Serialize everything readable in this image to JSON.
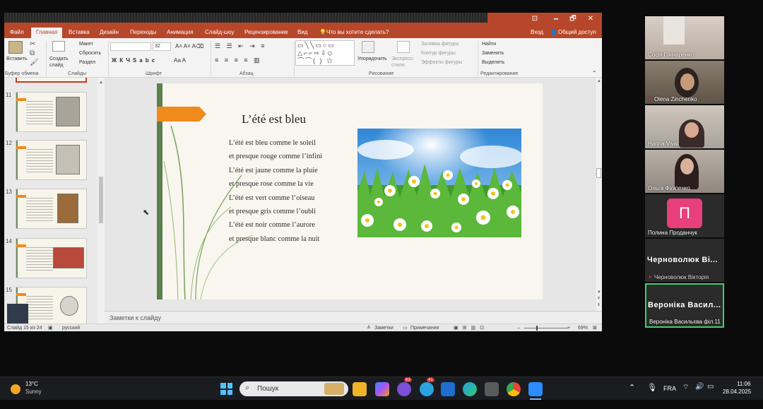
{
  "titlebar": {
    "sign_in": "Вход",
    "share": "Общий доступ",
    "min": "🗕",
    "restore": "🗗",
    "close": "✕",
    "ribbon_toggle": "⊡"
  },
  "tabs": [
    "Файл",
    "Главная",
    "Вставка",
    "Дизайн",
    "Переходы",
    "Анимация",
    "Слайд-шоу",
    "Рецензирование",
    "Вид"
  ],
  "tell_me": "Что вы хотите сделать?",
  "ribbon": {
    "paste": "Вставить",
    "clipboard": "Буфер обмена",
    "new_slide": "Создать слайд",
    "layout": "Макет",
    "reset": "Сбросить",
    "section": "Раздел",
    "slides_group": "Слайды",
    "font_size": "32",
    "font_group": "Шрифт",
    "paragraph_group": "Абзац",
    "arrange": "Упорядочить",
    "quick_styles": "Экспресс-стили",
    "shape_fill": "Заливка фигуры",
    "shape_outline": "Контур фигуры",
    "shape_effects": "Эффекты фигуры",
    "drawing_group": "Рисование",
    "find": "Найти",
    "replace": "Заменить",
    "select": "Выделить",
    "editing_group": "Редактирование"
  },
  "thumbnails": [
    {
      "num": "11"
    },
    {
      "num": "12"
    },
    {
      "num": "13"
    },
    {
      "num": "14"
    },
    {
      "num": "15"
    }
  ],
  "slide": {
    "title": "L’été est bleu",
    "lines": [
      "L’été est bleu comme le soleil",
      "et presque rouge comme l’infini",
      "L’été est jaune comme la pluie",
      "et presque rose comme la vie",
      "L’été est vert comme l’oiseau",
      "et presque gris comme l’oubli",
      "L’été est noir comme l’aurore",
      "et presque blanc comme la nuit"
    ]
  },
  "notes_placeholder": "Заметки к слайду",
  "status": {
    "slide_count": "Слайд 15 из 24",
    "language": "русский",
    "notes": "Заметки",
    "comments": "Примечания",
    "zoom": "69%"
  },
  "participants": [
    {
      "name": "Сосія Гончаренко"
    },
    {
      "name": "Olena Zinchenko"
    },
    {
      "name": "Hanna Vivat"
    },
    {
      "name": "Ольга Філіпенко"
    },
    {
      "name": "Полина Проданчук",
      "initial": "П",
      "color": "#e8407a"
    },
    {
      "name": "Черноволюк Вікторія",
      "display": "Черноволюк Ві..."
    },
    {
      "name": "Вероніка Васильєва філ 11",
      "display": "Вероніка Васил..."
    }
  ],
  "taskbar": {
    "temp": "13°C",
    "weather": "Sunny",
    "search": "Пошук",
    "lang": "FRA",
    "time": "11:06",
    "date": "28.04.2025",
    "badge_viber": "63",
    "badge_telegram": "41"
  }
}
